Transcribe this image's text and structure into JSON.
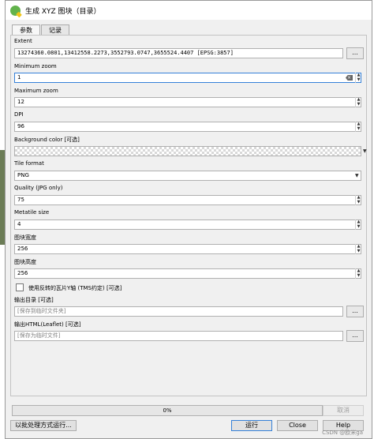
{
  "window": {
    "title": "生成 XYZ 图块（目录）"
  },
  "tabs": [
    "参数",
    "记录"
  ],
  "params": {
    "extent_label": "Extent",
    "extent_value": "13274360.0801,13412558.2273,3552793.0747,3655524.4407 [EPSG:3857]",
    "minzoom_label": "Minimum zoom",
    "minzoom_value": "1",
    "maxzoom_label": "Maximum zoom",
    "maxzoom_value": "12",
    "dpi_label": "DPI",
    "dpi_value": "96",
    "bgcolor_label": "Background color [可选]",
    "tileformat_label": "Tile format",
    "tileformat_value": "PNG",
    "quality_label": "Quality (JPG only)",
    "quality_value": "75",
    "metatile_label": "Metatile size",
    "metatile_value": "4",
    "tilewidth_label": "图块宽度",
    "tilewidth_value": "256",
    "tileheight_label": "图块高度",
    "tileheight_value": "256",
    "tms_label": "使用反转的瓦片Y轴 (TMS约定) [可选]",
    "tms_checked": false,
    "outdir_label": "输出目录 [可选]",
    "outdir_placeholder": "[保存到临时文件夹]",
    "outhtml_label": "输出HTML(Leaflet) [可选]",
    "outhtml_placeholder": "[保存为临时文件]",
    "browse_label": "..."
  },
  "footer": {
    "progress_text": "0%",
    "progress_value": 0,
    "cancel_label": "取消",
    "batch_label": "以批处理方式运行...",
    "run_label": "运行",
    "close_label": "Close",
    "help_label": "Help"
  },
  "watermark": "CSDN @欧米ga"
}
